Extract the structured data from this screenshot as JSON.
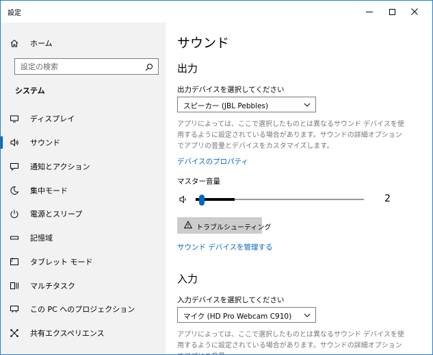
{
  "window": {
    "title": "設定"
  },
  "sidebar": {
    "home_label": "ホーム",
    "search_placeholder": "設定の検索",
    "section_heading": "システム",
    "items": [
      {
        "label": "ディスプレイ",
        "icon": "display-icon",
        "selected": false
      },
      {
        "label": "サウンド",
        "icon": "speaker-icon",
        "selected": true
      },
      {
        "label": "通知とアクション",
        "icon": "notification-icon",
        "selected": false
      },
      {
        "label": "集中モード",
        "icon": "moon-icon",
        "selected": false
      },
      {
        "label": "電源とスリープ",
        "icon": "power-icon",
        "selected": false
      },
      {
        "label": "記憶域",
        "icon": "storage-icon",
        "selected": false
      },
      {
        "label": "タブレット モード",
        "icon": "tablet-icon",
        "selected": false
      },
      {
        "label": "マルチタスク",
        "icon": "multitask-icon",
        "selected": false
      },
      {
        "label": "この PC へのプロジェクション",
        "icon": "projection-icon",
        "selected": false
      },
      {
        "label": "共有エクスペリエンス",
        "icon": "share-icon",
        "selected": false
      }
    ]
  },
  "main": {
    "page_title": "サウンド",
    "output": {
      "heading": "出力",
      "device_label": "出力デバイスを選択してください",
      "device_value": "スピーカー (JBL Pebbles)",
      "description": "アプリによっては、ここで選択したものとは異なるサウンド デバイスを使用するように設定されている場合があります。サウンドの詳細オプションでアプリの音量とデバイスをカスタマイズします。",
      "properties_link": "デバイスのプロパティ",
      "master_volume_label": "マスター音量",
      "volume_value": "2",
      "volume_fraction": 0.02,
      "troubleshoot_label": "トラブルシューティング",
      "manage_link": "サウンド デバイスを管理する"
    },
    "input": {
      "heading": "入力",
      "device_label": "入力デバイスを選択してください",
      "device_value": "マイク (HD Pro Webcam C910)",
      "description": "アプリによっては、ここで選択したものとは異なるサウンド デバイスを使用するように設定されている場合があります。サウンドの詳細オプションでアプリの音量"
    }
  },
  "colors": {
    "accent": "#0067c0",
    "sidebar_bg": "#f2f2f2",
    "window_border": "#1e7fd6",
    "description_text": "#767676",
    "button_bg": "#cccccc"
  }
}
